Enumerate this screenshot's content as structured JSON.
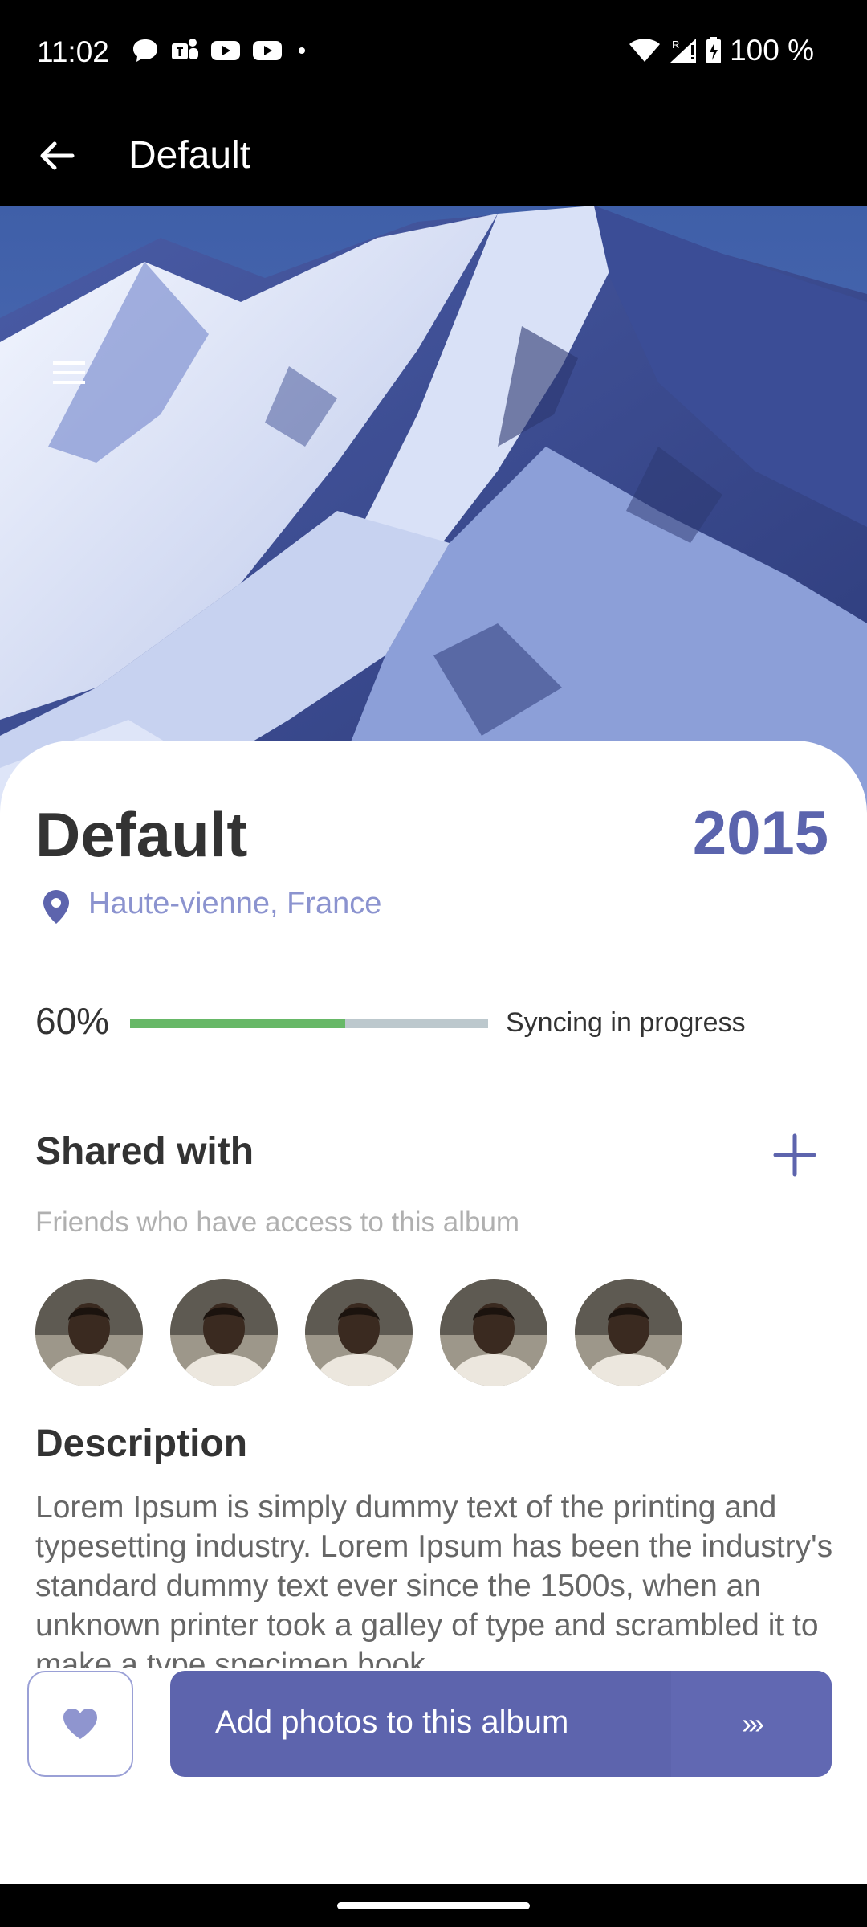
{
  "status_bar": {
    "time": "11:02",
    "notification_icons": [
      "chat-bubble-icon",
      "teams-icon",
      "youtube-icon",
      "youtube-icon",
      "more-dot-icon"
    ],
    "battery": "100 %",
    "right_icons": [
      "wifi-icon",
      "signal-roaming-icon",
      "battery-charging-icon"
    ]
  },
  "app_bar": {
    "title": "Default",
    "back_icon": "arrow-back-icon"
  },
  "hero": {
    "image": "snowy-mountain-peak",
    "menu_icon": "hamburger-menu-icon"
  },
  "album": {
    "title": "Default",
    "year": "2015",
    "location": "Haute-vienne, France"
  },
  "sync": {
    "percent_label": "60%",
    "progress": 0.6,
    "status": "Syncing in progress"
  },
  "shared": {
    "title": "Shared with",
    "subtitle": "Friends who have access to this album",
    "add_icon": "plus-icon",
    "friends_count": 5
  },
  "description": {
    "title": "Description",
    "text": "Lorem Ipsum is simply dummy text of the printing and typesetting industry. Lorem Ipsum has been the industry's standard dummy text ever since the 1500s, when an unknown printer took a galley of type and scrambled it to make a type specimen book."
  },
  "actions": {
    "like_icon": "heart-icon",
    "cta_label": "Add photos to this album",
    "cta_arrows": "›››"
  },
  "colors": {
    "accent": "#5d64ad",
    "year": "#5b64ad",
    "location": "#8b93cf",
    "progress_fill": "#67b867",
    "progress_track": "#bcc8cd"
  }
}
